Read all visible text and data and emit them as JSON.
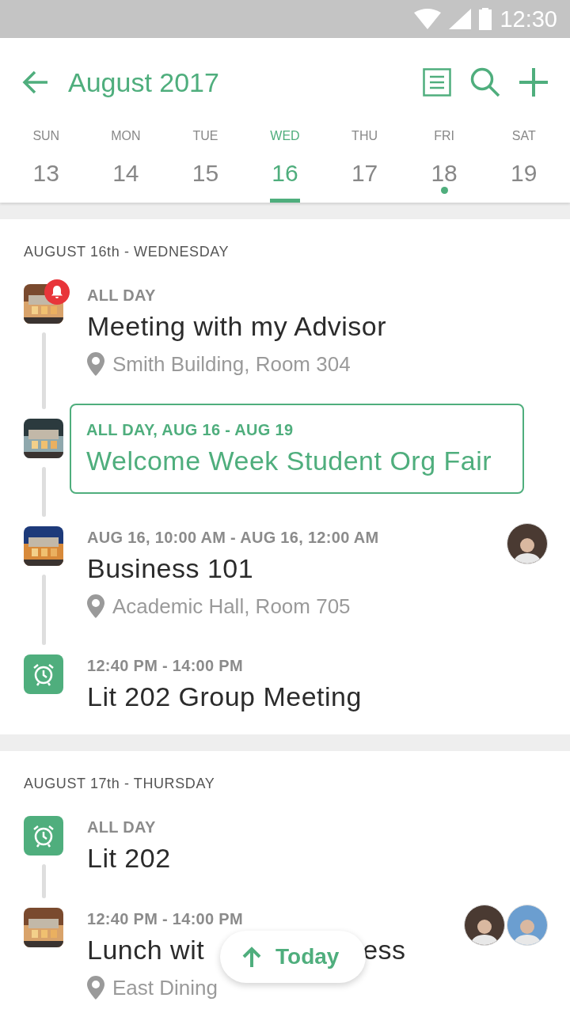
{
  "status_bar": {
    "time": "12:30"
  },
  "header": {
    "title": "August 2017"
  },
  "days": [
    {
      "weekday": "SUN",
      "date": "13",
      "selected": false,
      "has_event": false
    },
    {
      "weekday": "MON",
      "date": "14",
      "selected": false,
      "has_event": false
    },
    {
      "weekday": "TUE",
      "date": "15",
      "selected": false,
      "has_event": false
    },
    {
      "weekday": "WED",
      "date": "16",
      "selected": true,
      "has_event": false
    },
    {
      "weekday": "THU",
      "date": "17",
      "selected": false,
      "has_event": false
    },
    {
      "weekday": "FRI",
      "date": "18",
      "selected": false,
      "has_event": true
    },
    {
      "weekday": "SAT",
      "date": "19",
      "selected": false,
      "has_event": false
    }
  ],
  "sections": [
    {
      "heading": "AUGUST 16th - WEDNESDAY",
      "events": [
        {
          "kind": "picture",
          "alert": true,
          "highlighted": false,
          "time": "ALL DAY",
          "title": "Meeting with my Advisor",
          "location": "Smith Building, Room 304"
        },
        {
          "kind": "picture",
          "alert": false,
          "highlighted": true,
          "time": "ALL DAY, AUG 16 - AUG 19",
          "title": "Welcome Week Student Org Fair"
        },
        {
          "kind": "picture",
          "alert": false,
          "highlighted": false,
          "time": "AUG 16, 10:00 AM - AUG 16, 12:00 AM",
          "title": "Business 101",
          "location": "Academic Hall, Room 705",
          "attendees": [
            {
              "kind": "avatar"
            }
          ]
        },
        {
          "kind": "alarm",
          "alert": false,
          "highlighted": false,
          "time": "12:40 PM - 14:00 PM",
          "title": "Lit 202 Group Meeting"
        }
      ]
    },
    {
      "heading": "AUGUST 17th - THURSDAY",
      "events": [
        {
          "kind": "alarm",
          "alert": false,
          "highlighted": false,
          "time": "ALL DAY",
          "title": "Lit 202"
        },
        {
          "kind": "picture",
          "alert": false,
          "highlighted": false,
          "time": "12:40 PM - 14:00 PM",
          "title": "Lunch wit",
          "title_tail": "ess",
          "location": "East Dining",
          "attendees": [
            {
              "kind": "avatar"
            },
            {
              "kind": "avatar"
            }
          ]
        }
      ]
    }
  ],
  "today_button": {
    "label": "Today"
  }
}
